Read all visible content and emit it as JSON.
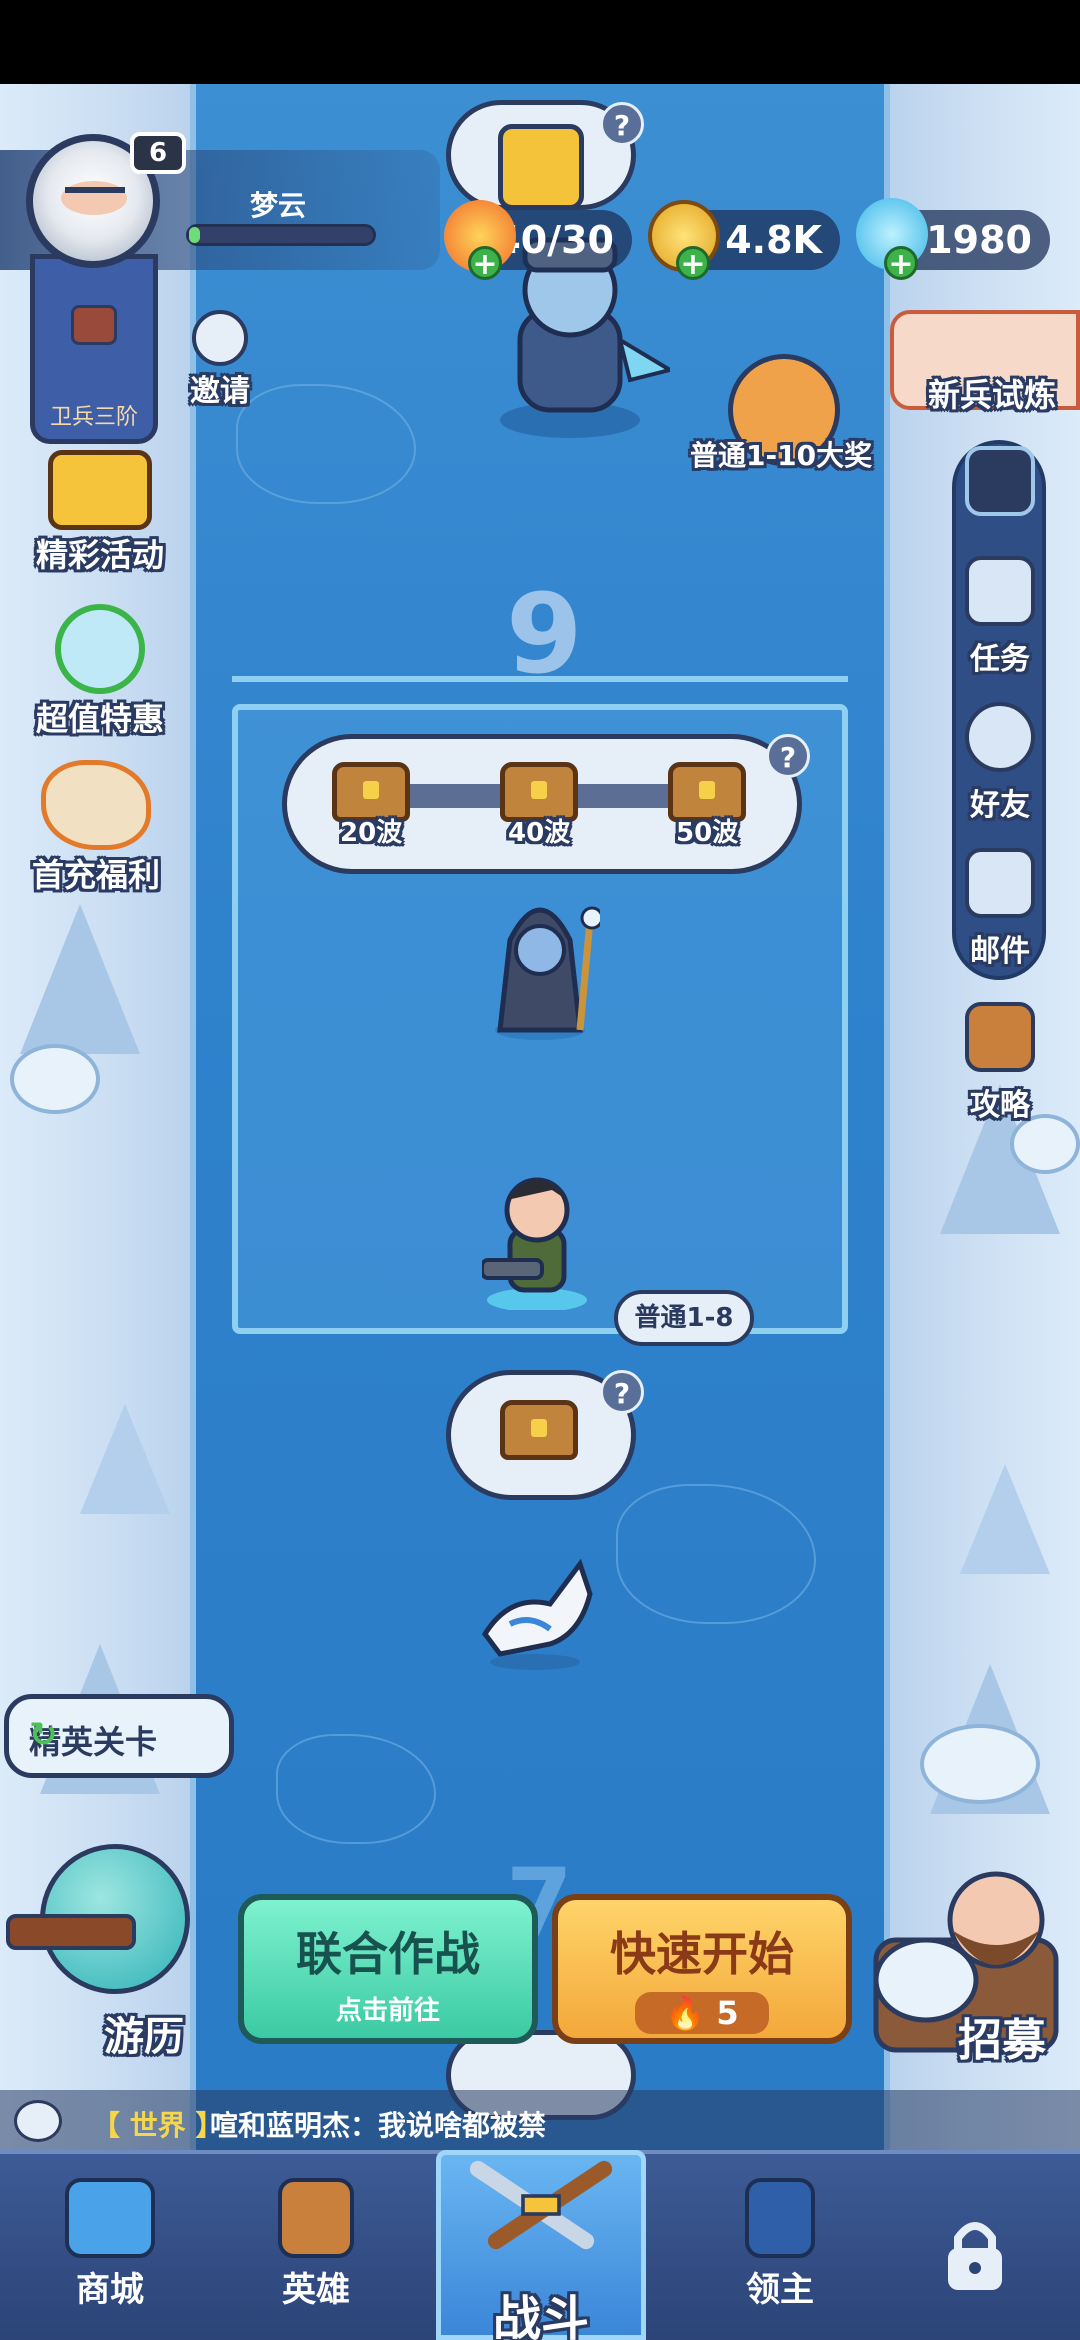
{
  "player": {
    "name": "梦云",
    "level": "6",
    "rank": "卫兵三阶",
    "xp_fraction": 0.06
  },
  "resources": {
    "stamina": "40/30",
    "gold": "4.8K",
    "gems": "1980"
  },
  "left_menu": {
    "invite": "邀请",
    "events": "精彩活动",
    "deals": "超值特惠",
    "first_recharge": "首充福利"
  },
  "right_menu": {
    "trial": "新兵试炼",
    "prize": "普通1-10大奖",
    "tasks": "任务",
    "friends": "好友",
    "mail": "邮件",
    "guide": "攻略"
  },
  "battle": {
    "current_wave_floor": "9",
    "next_floor": "7",
    "rewards": [
      {
        "label": "20波"
      },
      {
        "label": "40波"
      },
      {
        "label": "50波"
      }
    ],
    "stage_tag": "普通1-8"
  },
  "buttons": {
    "elite": "精英关卡",
    "travel": "游历",
    "coop_title": "联合作战",
    "coop_sub": "点击前往",
    "quick_title": "快速开始",
    "quick_cost": "5",
    "recruit": "招募"
  },
  "chat": {
    "channel": "【 世界 】",
    "message": "喧和蓝明杰：我说啥都被禁"
  },
  "nav": {
    "shop": "商城",
    "heroes": "英雄",
    "battle": "战斗",
    "lord": "领主"
  },
  "colors": {
    "river": "#2f82cc",
    "accent_green": "#3bcaa3",
    "accent_orange": "#f3a83a",
    "nav": "#2c4477"
  }
}
